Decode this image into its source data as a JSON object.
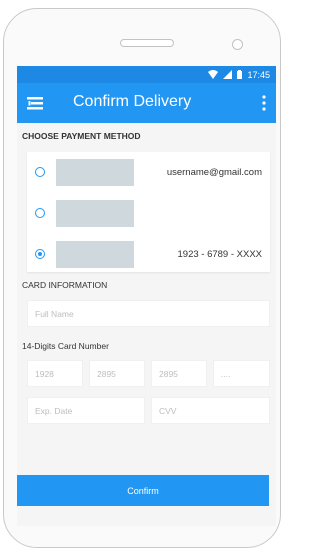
{
  "status_bar": {
    "time": "17:45",
    "icons": [
      "wifi-icon",
      "signal-icon",
      "battery-icon"
    ]
  },
  "app_bar": {
    "title": "Confirm Delivery",
    "left_icon": "menu-icon",
    "right_icon": "more-vertical-icon"
  },
  "payment": {
    "section_label": "CHOOSE PAYMENT METHOD",
    "options": [
      {
        "text": "username@gmail.com",
        "selected": false
      },
      {
        "text": "",
        "selected": false
      },
      {
        "text": "1923 - 6789 - XXXX",
        "selected": true
      }
    ]
  },
  "card_info": {
    "section_label": "CARD INFORMATION",
    "full_name_placeholder": "Full Name",
    "card_number_label": "14-Digits Card Number",
    "card_number_placeholders": [
      "1928",
      "2895",
      "2895",
      "...."
    ],
    "exp_date_placeholder": "Exp. Date",
    "cvv_placeholder": "CVV"
  },
  "confirm_label": "Confirm",
  "colors": {
    "primary": "#2196f3",
    "status_bar": "#1e88e5",
    "background": "#f5f5f5"
  }
}
